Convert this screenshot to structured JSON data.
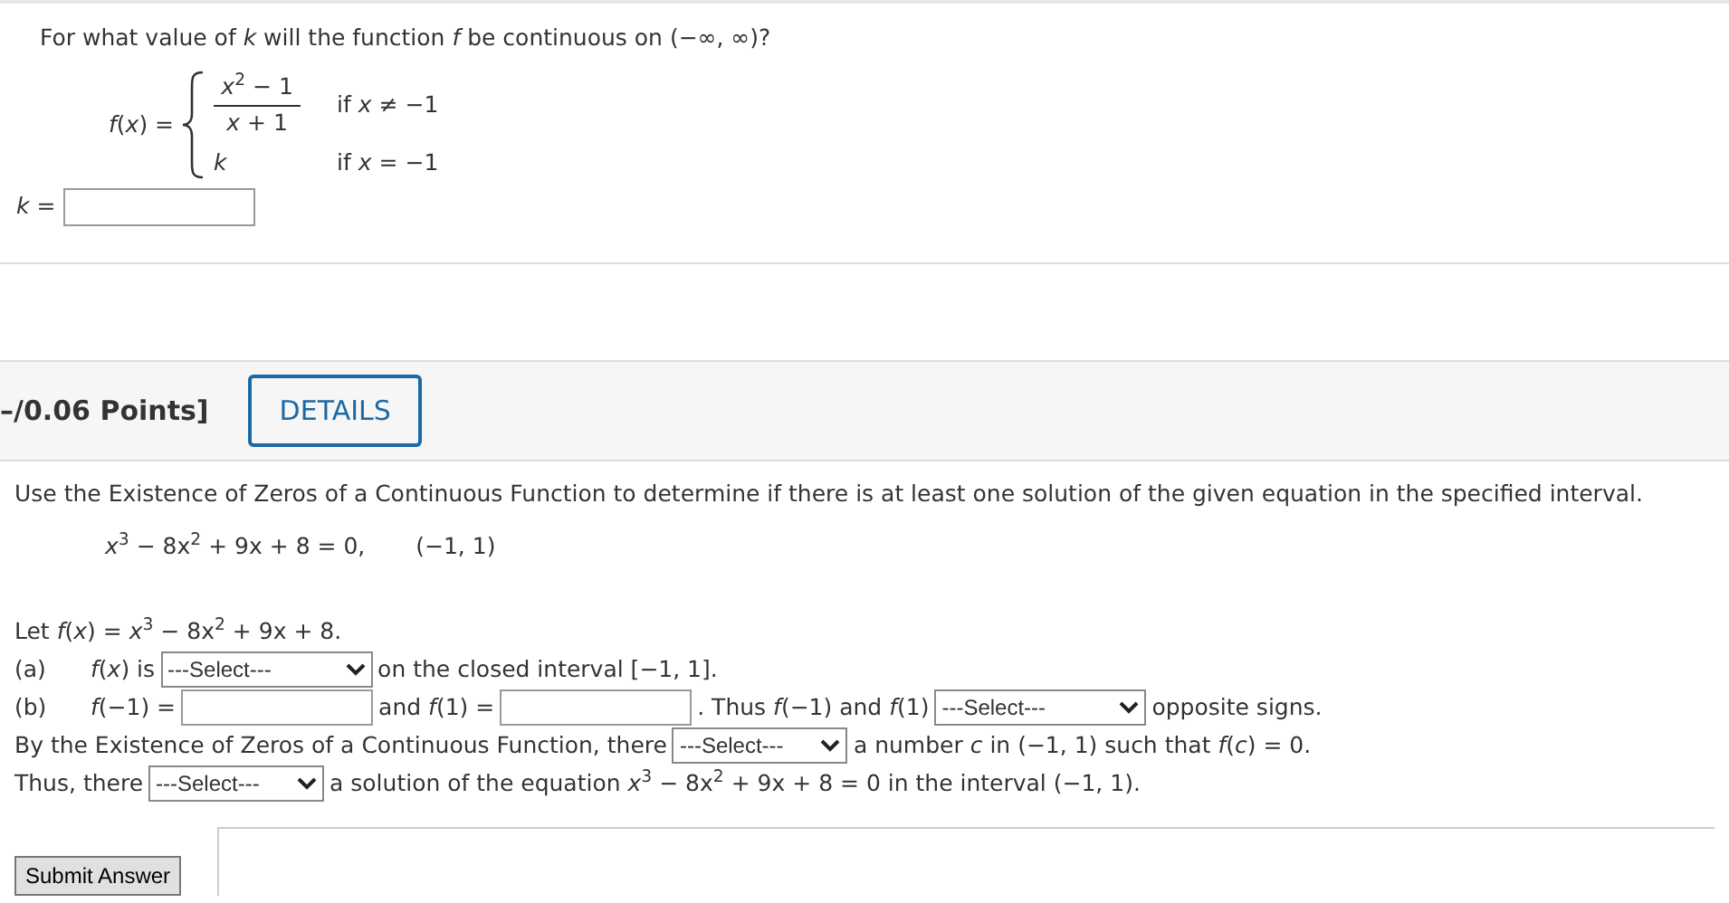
{
  "problem_1": {
    "question": "For what value of *k* will the function *f* be continuous on (−∞, ∞)?",
    "function": {
      "lhs": "*f*(*x*) =",
      "cases": [
        {
          "kind": "fraction",
          "numerator": "*x*$^{2}$ − 1",
          "denominator": "*x* + 1",
          "condition": "if *x* ≠ −1"
        },
        {
          "kind": "plain",
          "expression": "*k*",
          "condition": "if *x* = −1"
        }
      ]
    },
    "answer_label": "*k* ="
  },
  "problem_2": {
    "points": "–/0.06 Points]",
    "details_button": "DETAILS",
    "instruction": "Use the Existence of Zeros of a Continuous Function to determine if there is at least one solution of the given equation in the specified interval.",
    "equation": "*x*$^{3}$ − 8x$^{2}$ + 9x + 8 = 0,",
    "interval": "(−1, 1)",
    "lines": [
      [
        {
          "kind": "text",
          "text": "Let *f*(*x*) = *x*$^{3}$ − 8x$^{2}$ + 9x + 8."
        }
      ],
      [
        {
          "kind": "label",
          "text": "(a)"
        },
        {
          "kind": "text",
          "text": "*f*(*x*) is"
        },
        {
          "kind": "select",
          "value": "---Select---",
          "wide": true
        },
        {
          "kind": "text",
          "text": "on the closed interval [−1, 1]."
        }
      ],
      [
        {
          "kind": "label",
          "text": "(b)"
        },
        {
          "kind": "text",
          "text": "*f*(−1) ="
        },
        {
          "kind": "input"
        },
        {
          "kind": "text",
          "text": "and *f*(1) ="
        },
        {
          "kind": "input"
        },
        {
          "kind": "text",
          "text": ". Thus *f*(−1) and *f*(1)"
        },
        {
          "kind": "select",
          "value": "---Select---",
          "wide": true
        },
        {
          "kind": "text",
          "text": "opposite signs."
        }
      ],
      [
        {
          "kind": "text",
          "text": "By the Existence of Zeros of a Continuous Function, there"
        },
        {
          "kind": "select",
          "value": "---Select---",
          "wide": false
        },
        {
          "kind": "text",
          "text": "a number *c* in (−1, 1) such that *f*(*c*) = 0."
        }
      ],
      [
        {
          "kind": "text",
          "text": "Thus, there"
        },
        {
          "kind": "select",
          "value": "---Select---",
          "wide": false
        },
        {
          "kind": "text",
          "text": "a solution of the equation *x*$^{3}$ − 8x$^{2}$ + 9x + 8 = 0 in the interval (−1, 1)."
        }
      ]
    ],
    "submit_button": "Submit Answer"
  }
}
